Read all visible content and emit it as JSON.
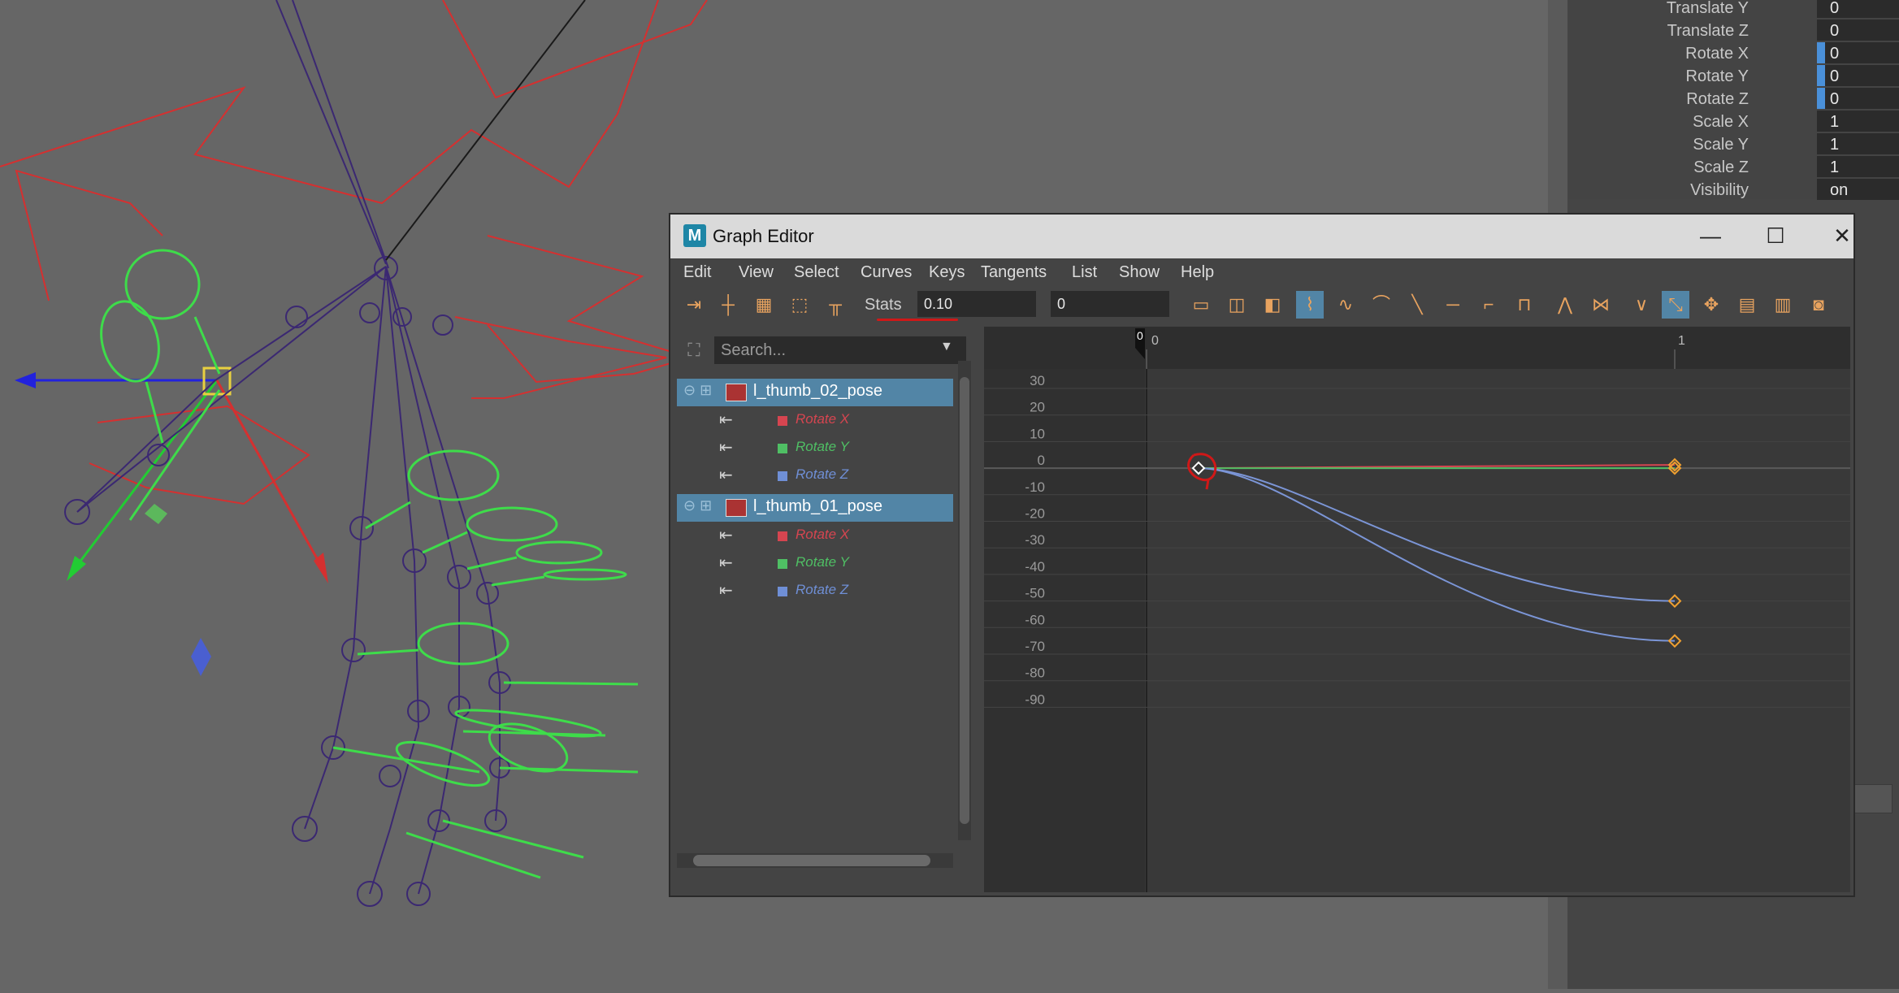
{
  "channel_box": {
    "rows": [
      {
        "label": "Translate Y",
        "value": "0",
        "keyed": false
      },
      {
        "label": "Translate Z",
        "value": "0",
        "keyed": false
      },
      {
        "label": "Rotate X",
        "value": "0",
        "keyed": true
      },
      {
        "label": "Rotate Y",
        "value": "0",
        "keyed": true
      },
      {
        "label": "Rotate Z",
        "value": "0",
        "keyed": true
      },
      {
        "label": "Scale X",
        "value": "1",
        "keyed": false
      },
      {
        "label": "Scale Y",
        "value": "1",
        "keyed": false
      },
      {
        "label": "Scale Z",
        "value": "1",
        "keyed": false
      },
      {
        "label": "Visibility",
        "value": "on",
        "keyed": false
      }
    ]
  },
  "graph_editor": {
    "title": "Graph Editor",
    "logo": "M",
    "window_buttons": {
      "minimize": "—",
      "maximize": "☐",
      "close": "✕"
    },
    "menus": [
      "Edit",
      "View",
      "Select",
      "Curves",
      "Keys",
      "Tangents",
      "List",
      "Show",
      "Help"
    ],
    "stats_label": "Stats",
    "stats_time": "0.10",
    "stats_value": "0",
    "search_placeholder": "Search...",
    "nodes": [
      {
        "name": "l_thumb_02_pose",
        "attributes": [
          {
            "name": "Rotate X",
            "color": "#d64550"
          },
          {
            "name": "Rotate Y",
            "color": "#4fbf64"
          },
          {
            "name": "Rotate Z",
            "color": "#6f8fd6"
          }
        ]
      },
      {
        "name": "l_thumb_01_pose",
        "attributes": [
          {
            "name": "Rotate X",
            "color": "#d64550"
          },
          {
            "name": "Rotate Y",
            "color": "#4fbf64"
          },
          {
            "name": "Rotate Z",
            "color": "#6f8fd6"
          }
        ]
      }
    ],
    "ruler": {
      "frame_start": "0",
      "current_frame": "0",
      "frame_end": "1"
    },
    "y_ticks": [
      "30",
      "20",
      "10",
      "0",
      "-10",
      "-20",
      "-30",
      "-40",
      "-50",
      "-60",
      "-70",
      "-80",
      "-90"
    ],
    "keys": {
      "start_value": 0,
      "end_frame": 1,
      "end_values": {
        "rotate_x": 0,
        "rotate_y": 0,
        "curve_a": -50,
        "curve_b": -65
      }
    }
  }
}
